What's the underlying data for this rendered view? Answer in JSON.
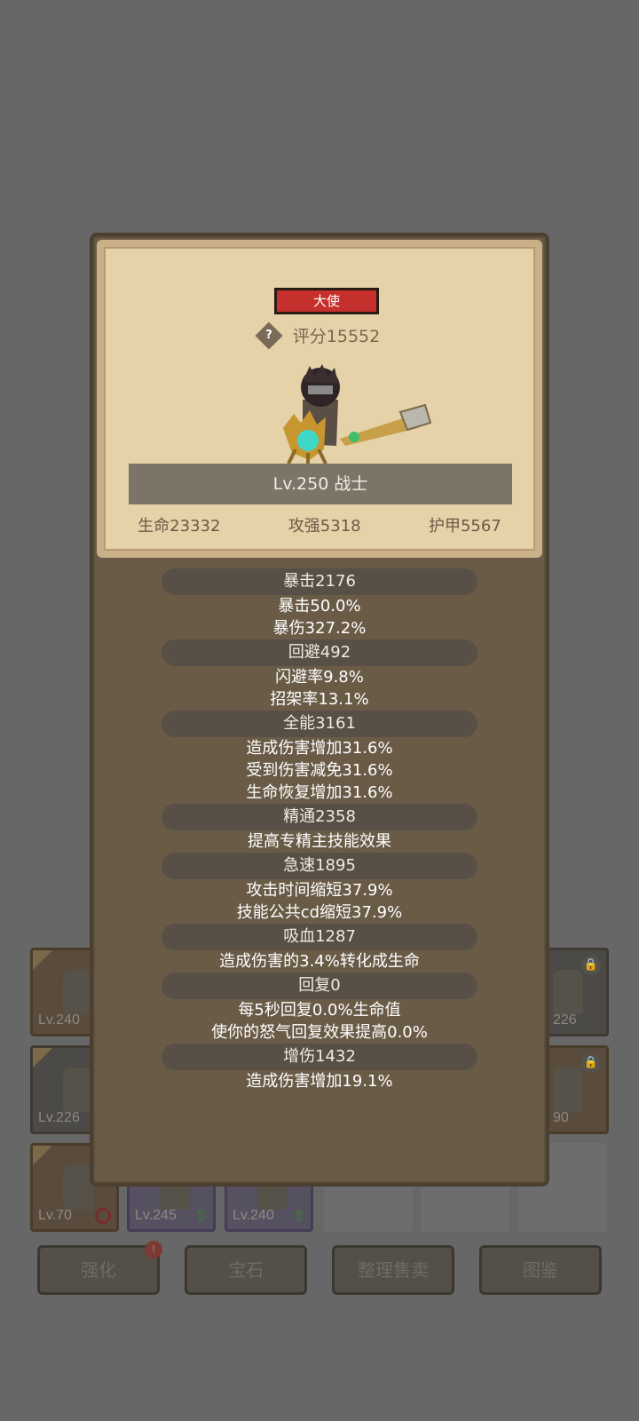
{
  "popup": {
    "class_badge": "大使",
    "help_icon_glyph": "?",
    "score_label": "评分15552",
    "level_label": "Lv.250 战士",
    "stats": [
      "生命23332",
      "攻强5318",
      "护甲5567"
    ],
    "attributes": [
      {
        "head": "暴击2176",
        "lines": [
          "暴击50.0%",
          "暴伤327.2%"
        ]
      },
      {
        "head": "回避492",
        "lines": [
          "闪避率9.8%",
          "招架率13.1%"
        ]
      },
      {
        "head": "全能3161",
        "lines": [
          "造成伤害增加31.6%",
          "受到伤害减免31.6%",
          "生命恢复增加31.6%"
        ]
      },
      {
        "head": "精通2358",
        "lines": [
          "提高专精主技能效果"
        ]
      },
      {
        "head": "急速1895",
        "lines": [
          "攻击时间缩短37.9%",
          "技能公共cd缩短37.9%"
        ]
      },
      {
        "head": "吸血1287",
        "lines": [
          "造成伤害的3.4%转化成生命"
        ]
      },
      {
        "head": "回复0",
        "lines": [
          "每5秒回复0.0%生命值",
          "使你的怒气回复效果提高0.0%"
        ]
      },
      {
        "head": "增伤1432",
        "lines": [
          "造成伤害增加19.1%"
        ]
      }
    ]
  },
  "inventory": {
    "slots": [
      {
        "level": "Lv.240",
        "style": "orange"
      },
      {
        "level": "226",
        "style": "locked"
      },
      {
        "level": "Lv.226",
        "style": "plain"
      },
      {
        "level": "90",
        "style": "locked"
      },
      {
        "level": "Lv.70",
        "style": "banned"
      },
      {
        "level": "Lv.245",
        "style": "purple-up"
      },
      {
        "level": "Lv.240",
        "style": "purple-up"
      }
    ]
  },
  "buttons": {
    "strengthen": "强化",
    "gem": "宝石",
    "sort_sell": "整理售卖",
    "codex": "图鉴",
    "notice_glyph": "!"
  },
  "colors": {
    "badge_red": "#c5302c",
    "card_parchment": "#e6d2a8",
    "panel_brown": "#6a5b47",
    "overlay_gray": "#676767"
  }
}
